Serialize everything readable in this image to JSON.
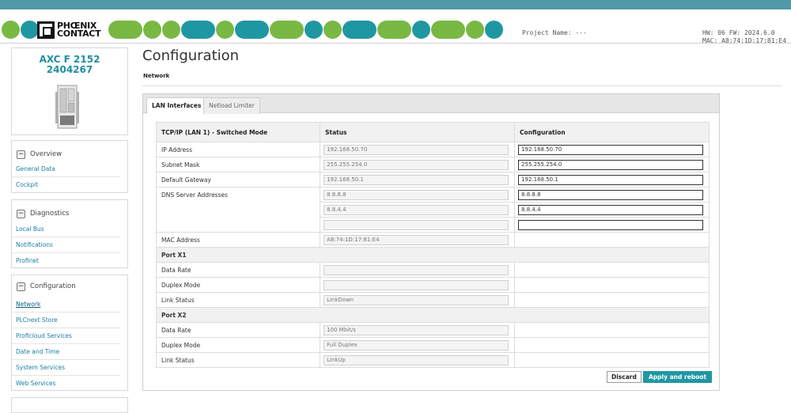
{
  "brand": {
    "logo_line1": "PHŒNIX",
    "logo_line2": "CONTACT",
    "green": "#78b843",
    "teal": "#1f97a3"
  },
  "header": {
    "project_label": "Project Name: ---",
    "hw_fw": "HW: 06 FW: 2024.6.0",
    "mac": "MAC: A8:74:1D:17:81:E4"
  },
  "device": {
    "name_line1": "AXC F 2152",
    "name_line2": "2404267"
  },
  "sidebar": {
    "overview": {
      "title": "Overview",
      "items": [
        "General Data",
        "Cockpit"
      ]
    },
    "diagnostics": {
      "title": "Diagnostics",
      "items": [
        "Local Bus",
        "Notifications",
        "Profinet"
      ]
    },
    "configuration": {
      "title": "Configuration",
      "items": [
        "Network",
        "PLCnext Store",
        "Proficloud Services",
        "Date and Time",
        "System Services",
        "Web Services"
      ]
    }
  },
  "main": {
    "title": "Configuration",
    "subtitle": "Network",
    "tabs": [
      "LAN Interfaces",
      "Netload Limiter"
    ],
    "table": {
      "headers": [
        "TCP/IP (LAN 1) - Switched Mode",
        "Status",
        "Configuration"
      ],
      "ip_label": "IP Address",
      "ip_status": "192.168.50.70",
      "ip_config": "192.168.50.70",
      "subnet_label": "Subnet Mask",
      "subnet_status": "255.255.254.0",
      "subnet_config": "255.255.254.0",
      "gateway_label": "Default Gateway",
      "gateway_status": "192.168.50.1",
      "gateway_config": "192.168.50.1",
      "dns_label": "DNS Server Addresses",
      "dns1_status": "8.8.8.8",
      "dns1_config": "8.8.8.8",
      "dns2_status": "8.8.4.4",
      "dns2_config": "8.8.4.4",
      "dns3_status": "",
      "dns3_config": "",
      "mac_label": "MAC Address",
      "mac_status": "A8:74:1D:17:81:E4",
      "port1_title": "Port X1",
      "port1_rate_label": "Data Rate",
      "port1_rate": "",
      "port1_duplex_label": "Duplex Mode",
      "port1_duplex": "",
      "port1_link_label": "Link Status",
      "port1_link": "LinkDown",
      "port2_title": "Port X2",
      "port2_rate_label": "Data Rate",
      "port2_rate": "100 Mbit/s",
      "port2_duplex_label": "Duplex Mode",
      "port2_duplex": "Full Duplex",
      "port2_link_label": "Link Status",
      "port2_link": "LinkUp"
    },
    "buttons": {
      "discard": "Discard",
      "apply": "Apply and reboot"
    }
  }
}
